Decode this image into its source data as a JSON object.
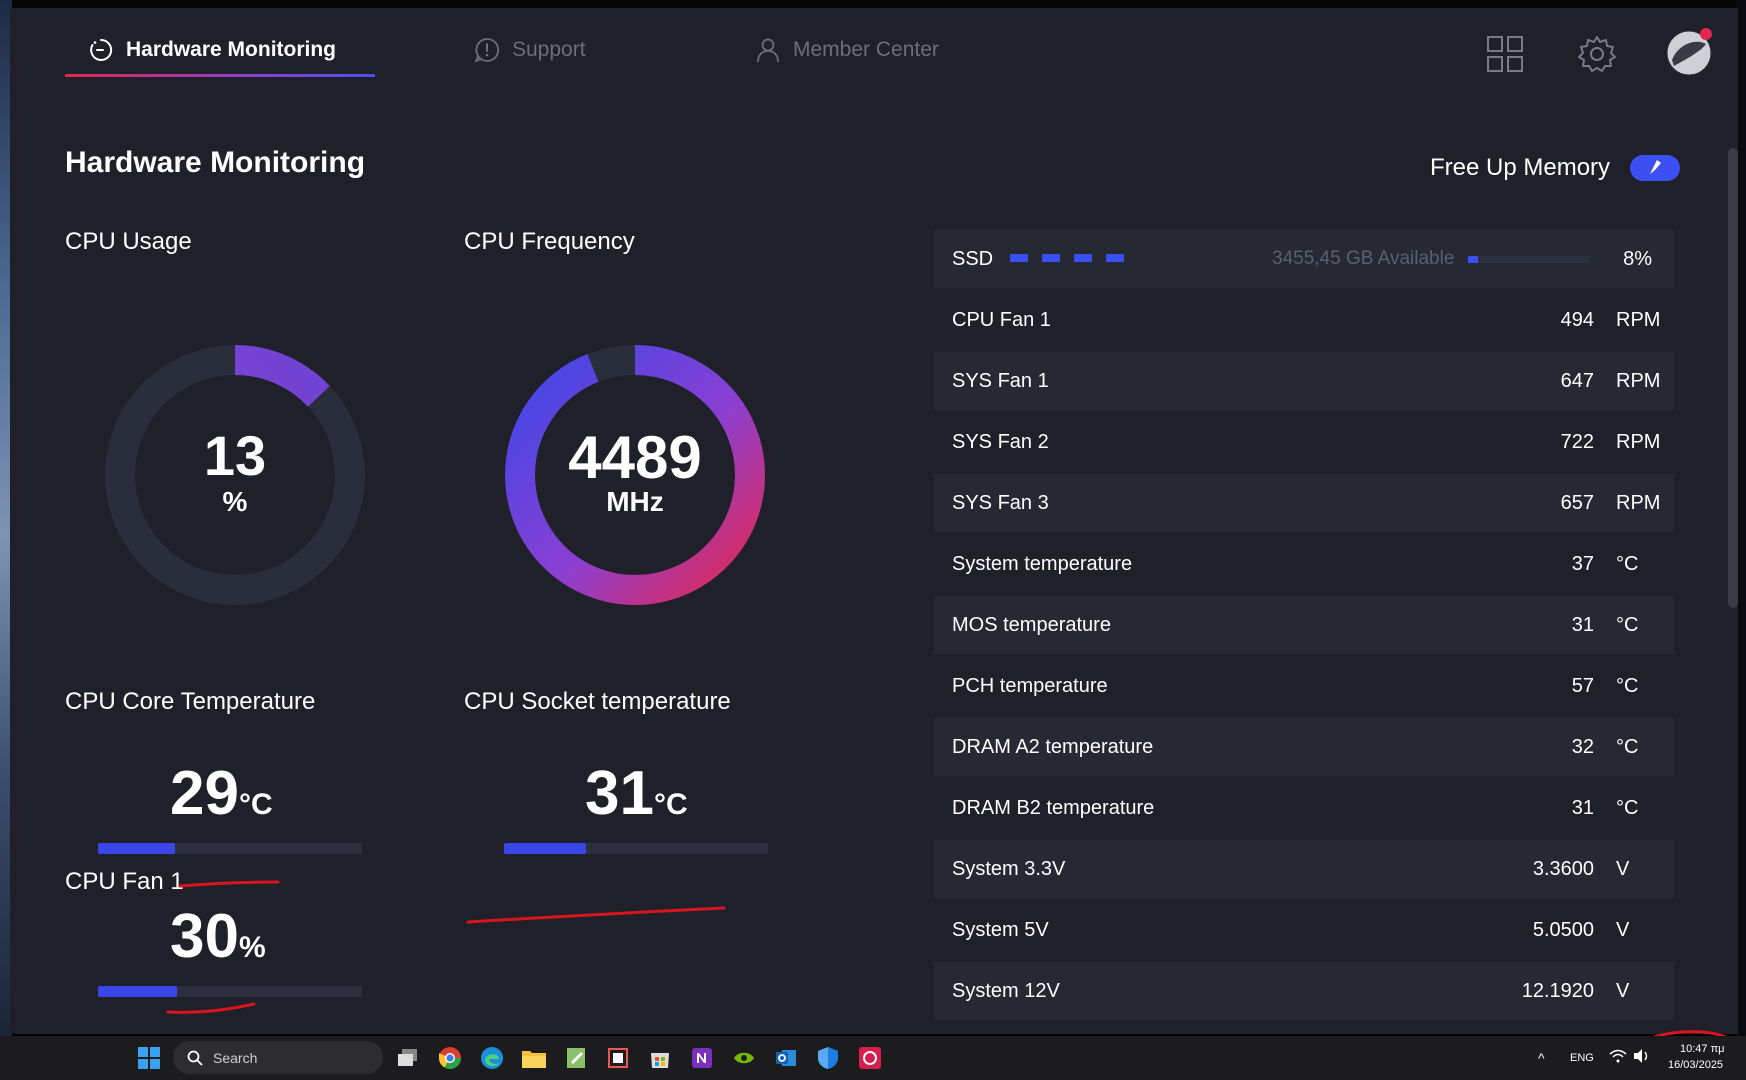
{
  "nav": {
    "tabs": [
      {
        "label": "Hardware Monitoring",
        "icon": "gauge-icon",
        "active": true
      },
      {
        "label": "Support",
        "icon": "alert-icon",
        "active": false
      },
      {
        "label": "Member Center",
        "icon": "user-icon",
        "active": false
      }
    ],
    "right_icons": [
      "grid-icon",
      "gear-icon",
      "avatar"
    ]
  },
  "page": {
    "title": "Hardware Monitoring",
    "free_memory_label": "Free Up Memory"
  },
  "cpu_usage": {
    "label": "CPU Usage",
    "value": "13",
    "unit": "%",
    "fraction": 0.13
  },
  "cpu_frequency": {
    "label": "CPU Frequency",
    "value": "4489",
    "unit": "MHz",
    "fraction": 0.94
  },
  "cpu_core_temp": {
    "label": "CPU Core Temperature",
    "value": "29",
    "unit": "°C",
    "fraction": 0.29
  },
  "cpu_socket_temp": {
    "label": "CPU Socket temperature",
    "value": "31",
    "unit": "°C",
    "fraction": 0.31
  },
  "cpu_fan": {
    "label": "CPU Fan 1",
    "value": "30",
    "unit": "%",
    "fraction": 0.3
  },
  "ssd": {
    "label": "SSD",
    "available": "3455,45 GB Available",
    "percent": "8%",
    "fraction": 0.08
  },
  "stats": [
    {
      "label": "CPU Fan 1",
      "value": "494",
      "unit": "RPM"
    },
    {
      "label": "SYS Fan 1",
      "value": "647",
      "unit": "RPM"
    },
    {
      "label": "SYS Fan 2",
      "value": "722",
      "unit": "RPM"
    },
    {
      "label": "SYS Fan 3",
      "value": "657",
      "unit": "RPM"
    },
    {
      "label": "System temperature",
      "value": "37",
      "unit": "°C"
    },
    {
      "label": "MOS temperature",
      "value": "31",
      "unit": "°C"
    },
    {
      "label": "PCH temperature",
      "value": "57",
      "unit": "°C"
    },
    {
      "label": "DRAM A2 temperature",
      "value": "32",
      "unit": "°C"
    },
    {
      "label": "DRAM B2 temperature",
      "value": "31",
      "unit": "°C"
    },
    {
      "label": "System 3.3V",
      "value": "3.3600",
      "unit": "V"
    },
    {
      "label": "System 5V",
      "value": "5.0500",
      "unit": "V"
    },
    {
      "label": "System 12V",
      "value": "12.1920",
      "unit": "V"
    }
  ],
  "taskbar": {
    "search_placeholder": "Search",
    "language": "ENG",
    "time": "10:47 πμ",
    "date": "16/03/2025"
  },
  "colors": {
    "accent_blue": "#3c4ff2",
    "accent_red": "#e0264e",
    "accent_purple": "#8a3fd3",
    "background": "#1f2029",
    "row_alt": "#262833"
  }
}
